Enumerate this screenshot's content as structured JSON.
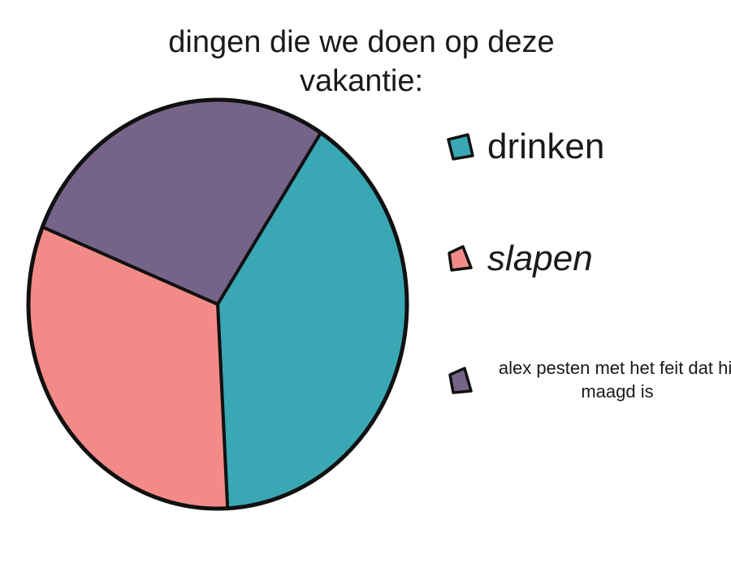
{
  "chart_data": {
    "type": "pie",
    "title": "dingen die we doen op deze vakantie:",
    "categories": [
      "drinken",
      "slapen",
      "alex pesten met het feit dat hij maagd is"
    ],
    "values": [
      40,
      32,
      28
    ],
    "colors": [
      "#3aa7b5",
      "#f28b87",
      "#766488"
    ],
    "legend_position": "right",
    "outline_color": "#111111"
  }
}
